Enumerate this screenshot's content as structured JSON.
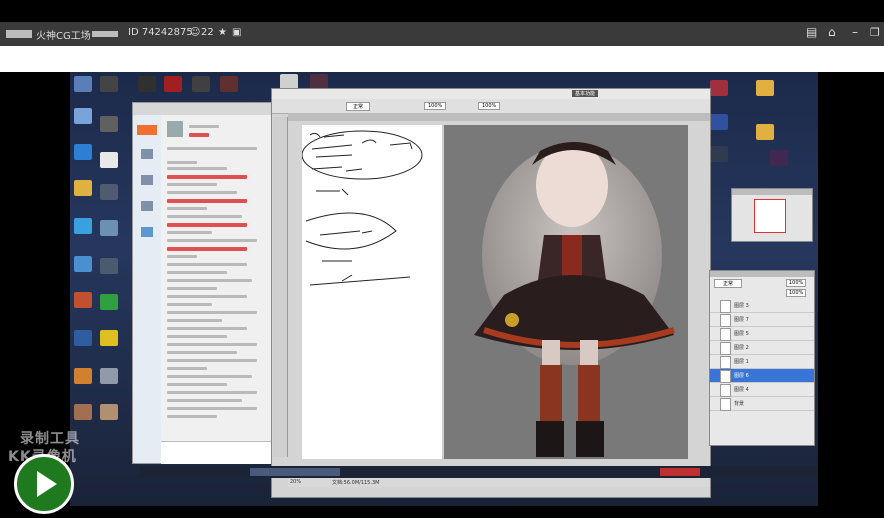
{
  "titlebar": {
    "channel": "火神CG工场",
    "room_id": "ID 74242875",
    "viewers": "22"
  },
  "photoshop": {
    "workspace": "基本功能",
    "zoom": "20%",
    "status": "文档:56.0M/115.3M",
    "layers": {
      "blend_mode": "正常",
      "opacity": "100%",
      "fill": "100%",
      "items": [
        "图层 3",
        "图层 7",
        "图层 5",
        "图层 2",
        "图层 1",
        "图层 6",
        "图层 4",
        "背景"
      ]
    }
  },
  "watermark": {
    "line1": "录制工具",
    "line2": "KK录像机"
  },
  "colors": {
    "titlebar": "#3a3a3a",
    "desktop": "#26375e",
    "play_button": "#1f7a1f",
    "selected_layer": "#3875d7"
  }
}
